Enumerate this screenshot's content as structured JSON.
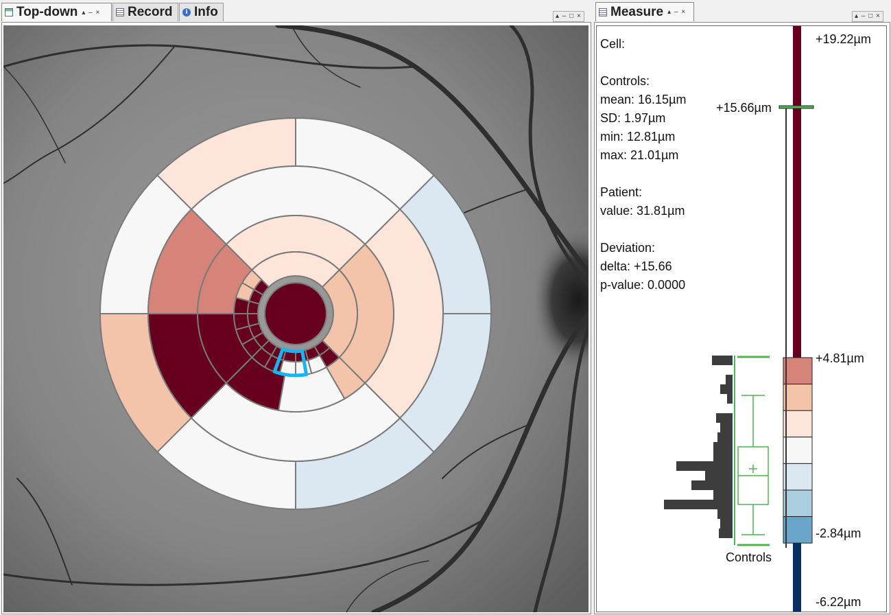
{
  "tabs_left": [
    {
      "label": "Top-down",
      "icon": "window-icon",
      "active": true
    },
    {
      "label": "Record",
      "icon": "table-icon",
      "active": false
    },
    {
      "label": "Info",
      "icon": "info-icon",
      "active": false
    }
  ],
  "tab_controls": "▴ – ×",
  "window_controls": "▴ – □ ×",
  "measure_tab": {
    "label": "Measure",
    "icon": "table-icon"
  },
  "measure": {
    "cell_label": "Cell:",
    "controls_label": "Controls:",
    "mean": "mean: 16.15µm",
    "sd": "SD: 1.97µm",
    "min": "min: 12.81µm",
    "max": "max: 21.01µm",
    "patient_label": "Patient:",
    "patient_value": "value: 31.81µm",
    "deviation_label": "Deviation:",
    "delta": "delta: +15.66",
    "pvalue": "p-value: 0.0000",
    "scale_top": "+19.22µm",
    "scale_marker": "+15.66µm",
    "scale_upper": "+4.81µm",
    "scale_lower": "-2.84µm",
    "scale_bottom": "-6.22µm",
    "controls_caption": "Controls"
  },
  "colors": {
    "dark_red": "#67001f",
    "red_3": "#d6847a",
    "red_2": "#f4c4aa",
    "red_1": "#fde5da",
    "neutral": "#f7f7f7",
    "blue_1": "#dbe8f1",
    "blue_2": "#abcee1",
    "blue_3": "#6aa5ca",
    "dark_blue": "#053061",
    "highlight": "#18b6f0",
    "controls_green": "#4fb44f",
    "histogram": "#3d3d3d"
  }
}
